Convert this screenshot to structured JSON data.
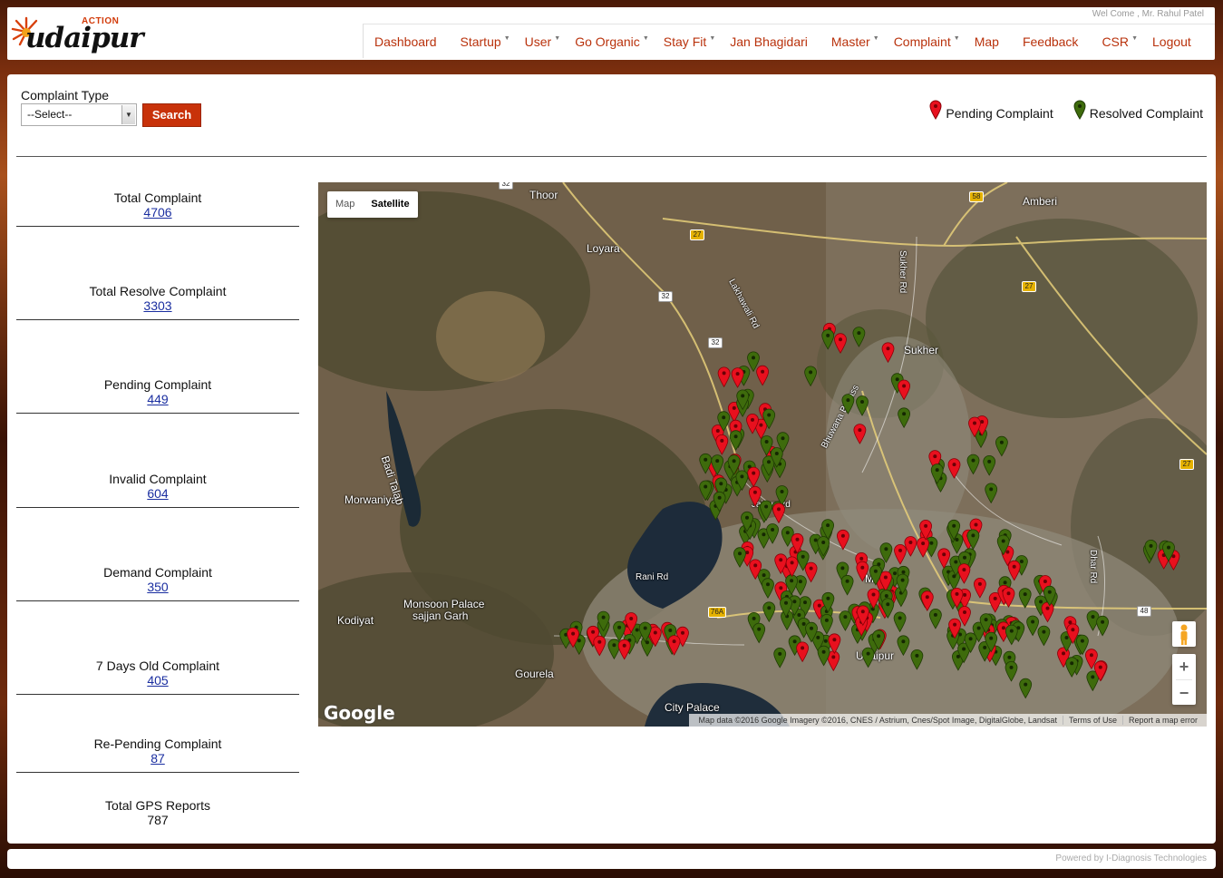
{
  "header": {
    "logo_action": "ACTION",
    "logo_brand": "udaipur",
    "welcome": "Wel Come , Mr. Rahul Patel",
    "nav": [
      {
        "label": "Dashboard",
        "dropdown": false
      },
      {
        "label": "Startup",
        "dropdown": true
      },
      {
        "label": "User",
        "dropdown": true
      },
      {
        "label": "Go Organic",
        "dropdown": true
      },
      {
        "label": "Stay Fit",
        "dropdown": true
      },
      {
        "label": "Jan Bhagidari",
        "dropdown": false
      },
      {
        "label": "Master",
        "dropdown": true
      },
      {
        "label": "Complaint",
        "dropdown": true
      },
      {
        "label": "Map",
        "dropdown": false
      },
      {
        "label": "Feedback",
        "dropdown": false
      },
      {
        "label": "CSR",
        "dropdown": true
      },
      {
        "label": "Logout",
        "dropdown": false
      }
    ]
  },
  "filter": {
    "label": "Complaint Type",
    "selected": "--Select--",
    "search_label": "Search"
  },
  "legend": {
    "pending": "Pending Complaint",
    "resolved": "Resolved Complaint",
    "pending_color": "#e8101e",
    "resolved_color": "#3e6b0c"
  },
  "stats": [
    {
      "label": "Total Complaint",
      "value": "4706"
    },
    {
      "label": "Total Resolve Complaint",
      "value": "3303"
    },
    {
      "label": "Pending Complaint",
      "value": "449"
    },
    {
      "label": "Invalid Complaint",
      "value": "604"
    },
    {
      "label": "Demand Complaint",
      "value": "350"
    },
    {
      "label": "7 Days Old Complaint",
      "value": "405"
    },
    {
      "label": "Re-Pending Complaint",
      "value": "87"
    },
    {
      "label": "Total GPS Reports",
      "value": "787"
    }
  ],
  "map": {
    "toggle_map": "Map",
    "toggle_satellite": "Satellite",
    "active_type": "Satellite",
    "places": [
      "Thoor",
      "Amberi",
      "Loyara",
      "Morwaniya",
      "Badi Talab",
      "Monsoon Palace",
      "sajjan Garh",
      "Kodiyat",
      "Goure​la",
      "City Palace",
      "Sukher",
      "Madri",
      "Udaipur",
      "Lakhawali Rd",
      "Sukher Rd",
      "Bhuwana Bypass",
      "Rani Rd",
      "Jaipur Rd",
      "Dhar Rd"
    ],
    "road_shields": [
      "32",
      "27",
      "58",
      "27",
      "32",
      "32",
      "27",
      "76A",
      "48"
    ],
    "google": "Google",
    "attribution": "Map data ©2016 Google Imagery ©2016, CNES / Astrium, Cnes/Spot Image, DigitalGlobe, Landsat",
    "terms": "Terms of Use",
    "report": "Report a map error",
    "zoom_in": "+",
    "zoom_out": "−"
  },
  "footer": {
    "powered": "Powered by I-Diagnosis Technologies"
  }
}
